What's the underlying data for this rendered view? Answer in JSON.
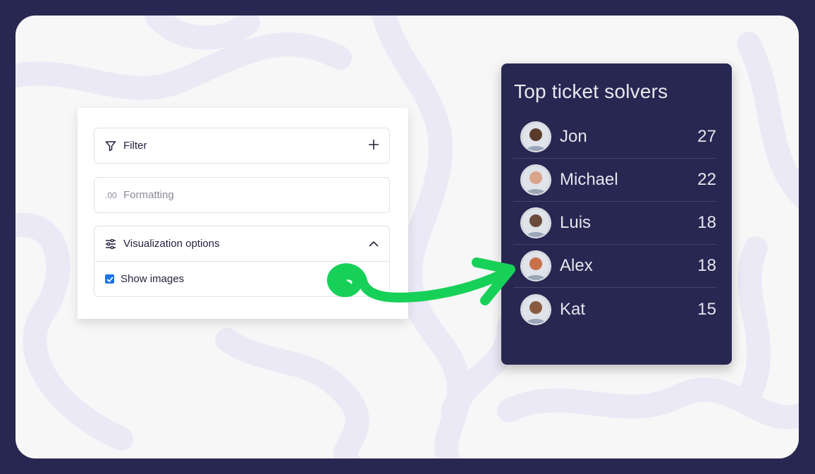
{
  "panel": {
    "filter": {
      "label": "Filter",
      "icon": "filter-icon",
      "action_icon": "plus-icon"
    },
    "formatting": {
      "prefix": ".00",
      "label": "Formatting"
    },
    "visualization": {
      "label": "Visualization options",
      "icon": "sliders-icon",
      "toggle_icon": "chevron-up-icon",
      "show_images": {
        "label": "Show images",
        "checked": true
      }
    }
  },
  "leaderboard": {
    "title": "Top ticket solvers",
    "items": [
      {
        "name": "Jon",
        "count": "27",
        "avatar_color": "#5a3a2a"
      },
      {
        "name": "Michael",
        "count": "22",
        "avatar_color": "#d9a58a"
      },
      {
        "name": "Luis",
        "count": "18",
        "avatar_color": "#6b4b3a"
      },
      {
        "name": "Alex",
        "count": "18",
        "avatar_color": "#c8704a"
      },
      {
        "name": "Kat",
        "count": "15",
        "avatar_color": "#8a5a3e"
      }
    ]
  },
  "colors": {
    "background": "#272752",
    "card": "#282752",
    "accent_arrow": "#17d058",
    "checkbox": "#1a73e8"
  }
}
